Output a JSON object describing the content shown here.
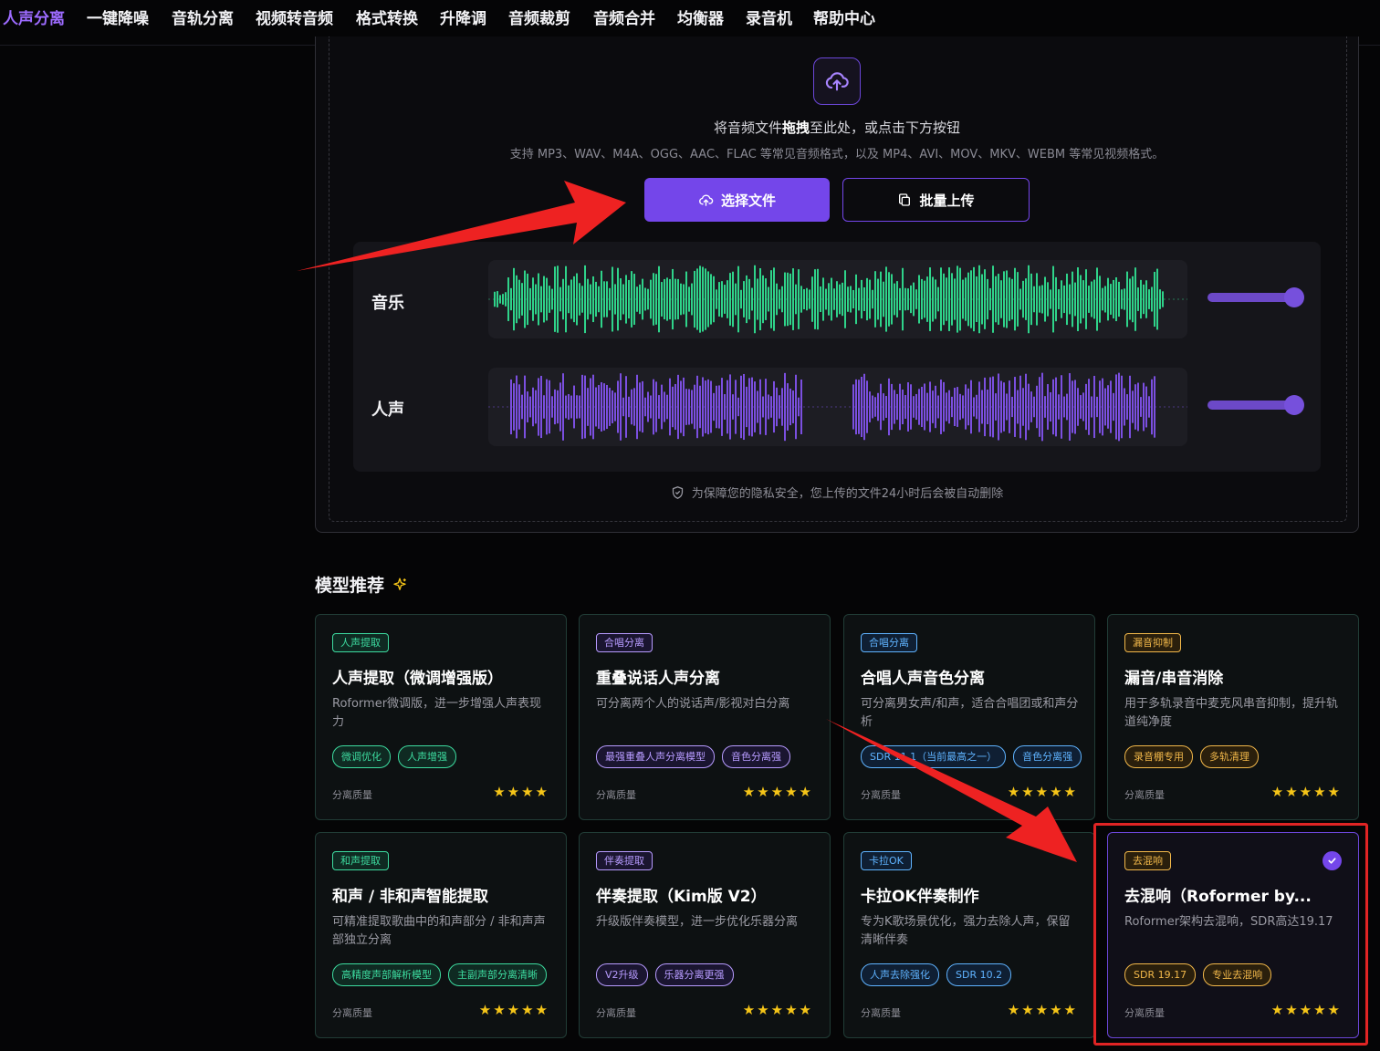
{
  "nav": {
    "items": [
      "人声分离",
      "一键降噪",
      "音轨分离",
      "视频转音频",
      "格式转换",
      "升降调",
      "音频裁剪",
      "音频合并",
      "均衡器",
      "录音机",
      "帮助中心"
    ],
    "active_index": 0
  },
  "upload": {
    "drop_prefix": "将音频文件",
    "drop_bold": "拖拽",
    "drop_suffix": "至此处，或点击下方按钮",
    "support": "支持 MP3、WAV、M4A、OGG、AAC、FLAC 等常见音频格式，以及 MP4、AVI、MOV、MKV、WEBM 等常见视频格式。",
    "select_button": "选择文件",
    "batch_button": "批量上传",
    "privacy": "为保障您的隐私安全，您上传的文件24小时后会被自动删除"
  },
  "demo": {
    "tracks": [
      {
        "label": "音乐",
        "color": "#2fd38a"
      },
      {
        "label": "人声",
        "color": "#7b4fe0"
      }
    ]
  },
  "models": {
    "title": "模型推荐",
    "quality_label": "分离质量",
    "cards": [
      {
        "tag": "人声提取",
        "tag_style": "teal",
        "title": "人声提取（微调增强版）",
        "desc": "Roformer微调版，进一步增强人声表现力",
        "chips": [
          "微调优化",
          "人声增强"
        ],
        "chip_style": "teal",
        "stars": 4
      },
      {
        "tag": "合唱分离",
        "tag_style": "purple",
        "title": "重叠说话人声分离",
        "desc": "可分离两个人的说话声/影视对白分离",
        "chips": [
          "最强重叠人声分离模型",
          "音色分离强"
        ],
        "chip_style": "purple",
        "stars": 5
      },
      {
        "tag": "合唱分离",
        "tag_style": "blue",
        "title": "合唱人声音色分离",
        "desc": "可分离男女声/和声，适合合唱团或和声分析",
        "chips": [
          "SDR 11.1（当前最高之一）",
          "音色分离强"
        ],
        "chip_style": "blue",
        "stars": 5
      },
      {
        "tag": "漏音抑制",
        "tag_style": "amber",
        "title": "漏音/串音消除",
        "desc": "用于多轨录音中麦克风串音抑制，提升轨道纯净度",
        "chips": [
          "录音棚专用",
          "多轨清理"
        ],
        "chip_style": "amber",
        "stars": 5
      },
      {
        "tag": "和声提取",
        "tag_style": "teal",
        "title": "和声 / 非和声智能提取",
        "desc": "可精准提取歌曲中的和声部分 / 非和声声部独立分离",
        "chips": [
          "高精度声部解析模型",
          "主副声部分离清晰"
        ],
        "chip_style": "teal",
        "stars": 5
      },
      {
        "tag": "伴奏提取",
        "tag_style": "purple",
        "title": "伴奏提取（Kim版 V2）",
        "desc": "升级版伴奏模型，进一步优化乐器分离",
        "chips": [
          "V2升级",
          "乐器分离更强"
        ],
        "chip_style": "purple",
        "stars": 5
      },
      {
        "tag": "卡拉OK",
        "tag_style": "blue",
        "title": "卡拉OK伴奏制作",
        "desc": "专为K歌场景优化，强力去除人声，保留清晰伴奏",
        "chips": [
          "人声去除强化",
          "SDR 10.2"
        ],
        "chip_style": "blue",
        "stars": 5
      },
      {
        "tag": "去混响",
        "tag_style": "amber",
        "title": "去混响（Roformer by...",
        "desc": "Roformer架构去混响，SDR高达19.17",
        "chips": [
          "SDR 19.17",
          "专业去混响"
        ],
        "chip_style": "amber",
        "stars": 5,
        "selected": true
      }
    ]
  },
  "icons": {
    "upload": "cloud-upload-icon",
    "batch": "copy-icon",
    "privacy": "shield-check-icon",
    "sparkle": "sparkle-icon",
    "check": "check-circle-icon",
    "star": "star-icon"
  }
}
